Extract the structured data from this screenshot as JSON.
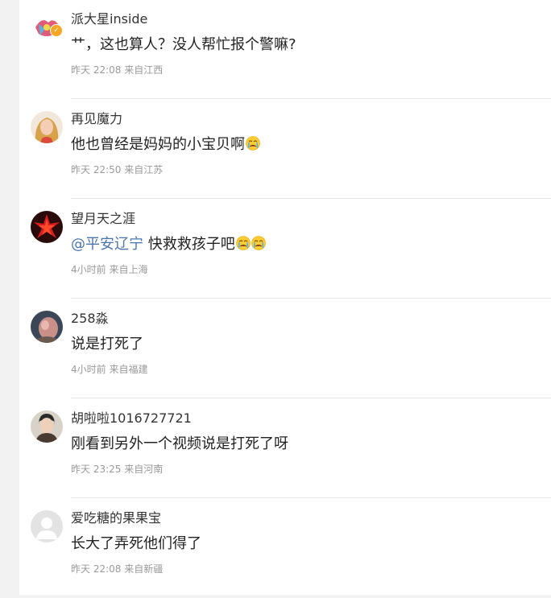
{
  "comments": [
    {
      "username": "派大星inside",
      "verified": true,
      "text": "艹，这也算人？没人帮忙报个警嘛?",
      "time": "昨天 22:08",
      "location": "来自江西"
    },
    {
      "username": "再见魔力",
      "text": "他也曾经是妈妈的小宝贝啊",
      "emojis": [
        "crying-face"
      ],
      "time": "昨天 22:50",
      "location": "来自江苏"
    },
    {
      "username": "望月天之涯",
      "mention": "@平安辽宁",
      "text": " 快救救孩子吧",
      "emojis": [
        "crying-face",
        "crying-face"
      ],
      "time": "4小时前",
      "location": "来自上海"
    },
    {
      "username": "258淼",
      "text": "说是打死了",
      "time": "4小时前",
      "location": "来自福建"
    },
    {
      "username": "胡啦啦1016727721",
      "text": "刚看到另外一个视频说是打死了呀",
      "time": "昨天 23:25",
      "location": "来自河南"
    },
    {
      "username": "爱吃糖的果果宝",
      "text": "长大了弄死他们得了",
      "time": "昨天 22:08",
      "location": "来自新疆"
    }
  ],
  "colors": {
    "mention": "#4a75a8",
    "verified_badge": "#f5a623",
    "meta_text": "#999999"
  }
}
